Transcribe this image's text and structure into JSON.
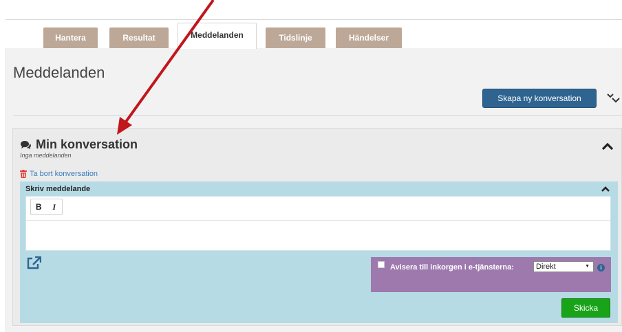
{
  "tabs": [
    {
      "label": "Hantera",
      "active": false
    },
    {
      "label": "Resultat",
      "active": false
    },
    {
      "label": "Meddelanden",
      "active": true
    },
    {
      "label": "Tidslinje",
      "active": false
    },
    {
      "label": "Händelser",
      "active": false
    }
  ],
  "page": {
    "title": "Meddelanden"
  },
  "actions": {
    "new_conversation": "Skapa ny konversation"
  },
  "conversation": {
    "title": "Min konversation",
    "subtitle": "Inga meddelanden",
    "delete_label": "Ta bort konversation"
  },
  "compose": {
    "title": "Skriv meddelande",
    "bold_label": "B",
    "italic_label": "I",
    "notify_label": "Avisera till inkorgen i e-tjänsterna:",
    "notify_checked": false,
    "notify_option": "Direkt",
    "send_label": "Skicka"
  },
  "colors": {
    "primary": "#2f6491",
    "compose_bg": "#b7dbe5",
    "notify_bg": "#9d79ae",
    "send": "#18a318",
    "tab": "#bda898",
    "annotation_arrow": "#c0161c"
  },
  "icons": [
    "comment-icon",
    "trash-icon",
    "chevron-down-icon",
    "chevron-up-icon",
    "external-link-icon",
    "info-icon",
    "annotation-arrow"
  ]
}
